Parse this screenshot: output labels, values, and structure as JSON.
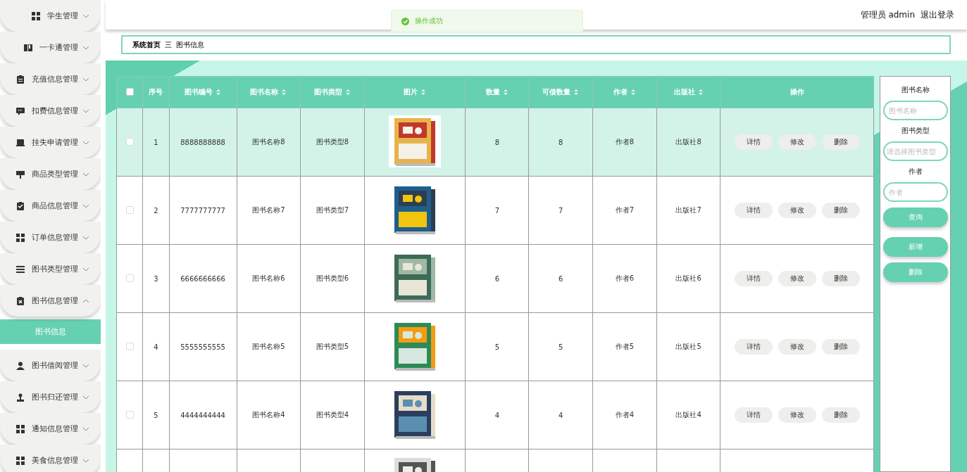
{
  "header": {
    "user_label": "管理员 admin",
    "logout": "退出登录"
  },
  "toast": {
    "message": "操作成功"
  },
  "sidebar": {
    "items": [
      {
        "label": "学生管理",
        "expanded": false
      },
      {
        "label": "一卡通管理",
        "expanded": false
      },
      {
        "label": "充值信息管理",
        "expanded": false
      },
      {
        "label": "扣费信息管理",
        "expanded": false
      },
      {
        "label": "挂失申请管理",
        "expanded": false
      },
      {
        "label": "商品类型管理",
        "expanded": false
      },
      {
        "label": "商品信息管理",
        "expanded": false
      },
      {
        "label": "订单信息管理",
        "expanded": false
      },
      {
        "label": "图书类型管理",
        "expanded": false
      },
      {
        "label": "图书信息管理",
        "expanded": true,
        "children": [
          {
            "label": "图书信息",
            "selected": true
          }
        ]
      },
      {
        "label": "图书借阅管理",
        "expanded": false
      },
      {
        "label": "图书归还管理",
        "expanded": false
      },
      {
        "label": "通知信息管理",
        "expanded": false
      },
      {
        "label": "美食信息管理",
        "expanded": false
      }
    ]
  },
  "breadcrumb": {
    "home": "系统首页",
    "separator": "三",
    "current": "图书信息"
  },
  "table": {
    "header_checkbox": {
      "checked": false
    },
    "columns": [
      {
        "label": "序号",
        "kind": "text",
        "sortable": false
      },
      {
        "label": "图书编号",
        "kind": "text",
        "sortable": true
      },
      {
        "label": "图书名称",
        "kind": "text",
        "sortable": true
      },
      {
        "label": "图书类型",
        "kind": "text",
        "sortable": true
      },
      {
        "label": "图片",
        "sortable": true
      },
      {
        "label": "数量",
        "kind": "text",
        "sortable": true
      },
      {
        "label": "可借数量",
        "kind": "text",
        "sortable": true
      },
      {
        "label": "作者",
        "kind": "text",
        "sortable": true
      },
      {
        "label": "出版社",
        "kind": "text",
        "sortable": true
      },
      {
        "label": "操作",
        "kind": "actions",
        "sortable": false
      }
    ],
    "rows": [
      {
        "selected": true,
        "checked": false,
        "cells": [
          "1",
          "8888888888",
          "图书名称8",
          "图书类型8",
          "",
          "8",
          "8",
          "作者8",
          "出版社8"
        ],
        "actions": [
          "详情",
          "修改",
          "删除"
        ]
      },
      {
        "selected": false,
        "checked": false,
        "cells": [
          "2",
          "7777777777",
          "图书名称7",
          "图书类型7",
          "",
          "7",
          "7",
          "作者7",
          "出版社7"
        ],
        "actions": [
          "详情",
          "修改",
          "删除"
        ]
      },
      {
        "selected": false,
        "checked": false,
        "cells": [
          "3",
          "6666666666",
          "图书名称6",
          "图书类型6",
          "",
          "6",
          "6",
          "作者6",
          "出版社6"
        ],
        "actions": [
          "详情",
          "修改",
          "删除"
        ]
      },
      {
        "selected": false,
        "checked": false,
        "cells": [
          "4",
          "5555555555",
          "图书名称5",
          "图书类型5",
          "",
          "5",
          "5",
          "作者5",
          "出版社5"
        ],
        "actions": [
          "详情",
          "修改",
          "删除"
        ]
      },
      {
        "selected": false,
        "checked": false,
        "cells": [
          "5",
          "4444444444",
          "图书名称4",
          "图书类型4",
          "",
          "4",
          "4",
          "作者4",
          "出版社4"
        ],
        "actions": [
          "详情",
          "修改",
          "删除"
        ]
      }
    ]
  },
  "search": {
    "fields": [
      {
        "label": "图书名称",
        "placeholder": "图书名称",
        "kind": "input"
      },
      {
        "label": "图书类型",
        "placeholder": "请选择图书类型",
        "kind": "select"
      },
      {
        "label": "作者",
        "placeholder": "作者",
        "kind": "input"
      }
    ],
    "buttons": [
      "查询",
      "新增",
      "删除"
    ]
  }
}
